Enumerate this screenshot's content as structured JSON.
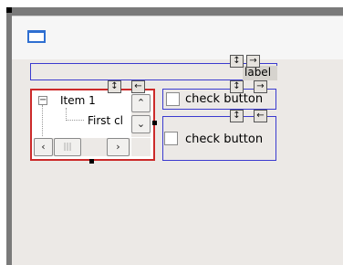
{
  "label": {
    "text": "label"
  },
  "tree": {
    "expander": "−",
    "item1": "Item 1",
    "child": "First cl",
    "vscroll_up": "⌃",
    "vscroll_down": "⌄",
    "hscroll_left": "‹",
    "hscroll_thumb": "|||",
    "hscroll_right": "›"
  },
  "checkbuttons": [
    {
      "label": "check button"
    },
    {
      "label": "check button"
    }
  ],
  "icons": {
    "vexpand": "↕",
    "hexpand": "→",
    "hshrink": "←"
  },
  "colors": {
    "selected_border": "#cc2a2a",
    "widget_border": "#3b3bcf",
    "client_bg": "#ece9e6"
  }
}
